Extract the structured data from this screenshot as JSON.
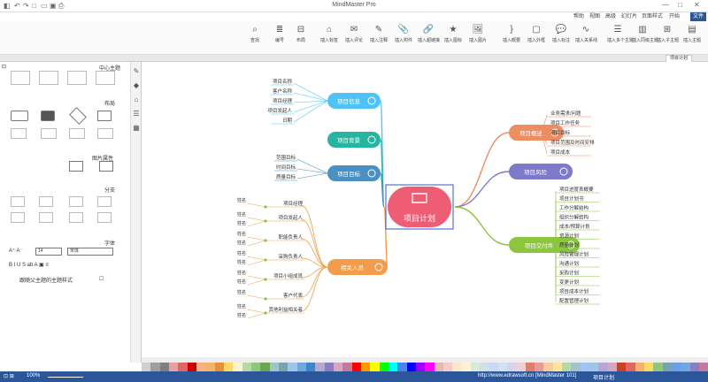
{
  "app": {
    "title": "MindMaster Pro"
  },
  "menus": [
    "文件",
    "开始",
    "页面样式",
    "幻灯片",
    "高级",
    "视图",
    "帮助"
  ],
  "ribbon": [
    "插入主题",
    "插入子主题",
    "插入同级主题",
    "插入多个主题",
    "插入关系线",
    "插入标注",
    "插入外框",
    "插入概要",
    "插入图片",
    "插入图标",
    "插入超链接",
    "插入附件",
    "插入注释",
    "插入评论",
    "插入标签",
    "布局",
    "编号",
    "查找"
  ],
  "left_panel": {
    "title": "中心主题",
    "layout_title": "布局",
    "branch_title": "分支",
    "style_title": "图片属性",
    "font_title": "字体",
    "font_name": "宋体",
    "font_size": "14",
    "checkbox_label": "跟随父主题的主题样式"
  },
  "doc_tab": "项目计划",
  "status": {
    "zoom": "100%",
    "center": "项目计划",
    "url": "http://www.edrawsoft.cn [MindMaster 101]"
  },
  "colors": {
    "accent": "#2b579a",
    "center": "#ef5d75"
  },
  "nodes": {
    "center": "项目计划",
    "info": "项目信息",
    "background": "项目背景",
    "goal": "项目目标",
    "people": "相关人员",
    "notes": "项目概述",
    "risk": "项目风险",
    "deliver": "项目交付件"
  },
  "info_items": [
    "项目名称",
    "客户名称",
    "项目经理",
    "项目发起人",
    "日期"
  ],
  "goal_items": [
    "范围目标",
    "时间目标",
    "质量目标"
  ],
  "notes_items": [
    "业务需求/问题",
    "项目工作任务",
    "项目目标",
    "项目范围及时间安排",
    "项目成本"
  ],
  "deliver_items": [
    "项目进度表概要",
    "项目计划书",
    "工作分解结构",
    "组织分解结构",
    "成本/预算计划",
    "资源计划",
    "质量计划",
    "风险管理计划",
    "沟通计划",
    "采购计划",
    "变更计划",
    "项目成本计划",
    "配置管理计划"
  ],
  "people_groups": [
    {
      "label": "项目经理",
      "leaves": [
        "姓名"
      ]
    },
    {
      "label": "项目发起人",
      "leaves": [
        "姓名",
        "姓名"
      ]
    },
    {
      "label": "职能负责人",
      "leaves": [
        "姓名",
        "姓名"
      ]
    },
    {
      "label": "采购负责人",
      "leaves": [
        "姓名",
        "姓名"
      ]
    },
    {
      "label": "项目小组成员",
      "leaves": [
        "姓名",
        "姓名"
      ]
    },
    {
      "label": "客户代表",
      "leaves": [
        "姓名"
      ]
    },
    {
      "label": "其他利益相关者",
      "leaves": [
        "姓名",
        "姓名"
      ]
    }
  ],
  "palette": [
    "#cfcfcf",
    "#9e9e9e",
    "#7f7f7f",
    "#e8a0a0",
    "#e06666",
    "#cc0000",
    "#f4b183",
    "#f6b26b",
    "#e69138",
    "#ffd966",
    "#fff2cc",
    "#b6d7a8",
    "#93c47d",
    "#6aa84f",
    "#a2c4c9",
    "#76a5af",
    "#9fc5e8",
    "#6fa8dc",
    "#3d85c6",
    "#b4a7d6",
    "#8e7cc3",
    "#d5a6bd",
    "#c27ba0",
    "#ff0000",
    "#ff9900",
    "#ffff00",
    "#00ff00",
    "#00ffff",
    "#4a86e8",
    "#0000ff",
    "#9900ff",
    "#ff00ff",
    "#e6b8af",
    "#f4cccc",
    "#fce5cd",
    "#fff2cc",
    "#d9ead3",
    "#d0e0e3",
    "#c9daf8",
    "#cfe2f3",
    "#d9d2e9",
    "#ead1dc",
    "#dd7e6b",
    "#ea9999",
    "#f9cb9c",
    "#ffe599",
    "#b6d7a8",
    "#a2c4c9",
    "#a4c2f4",
    "#9fc5e8",
    "#b4a7d6",
    "#d5a6bd",
    "#cc4125",
    "#e06666",
    "#f6b26b",
    "#ffd966",
    "#93c47d",
    "#76a5af",
    "#6d9eeb",
    "#6fa8dc",
    "#8e7cc3",
    "#c27ba0"
  ]
}
